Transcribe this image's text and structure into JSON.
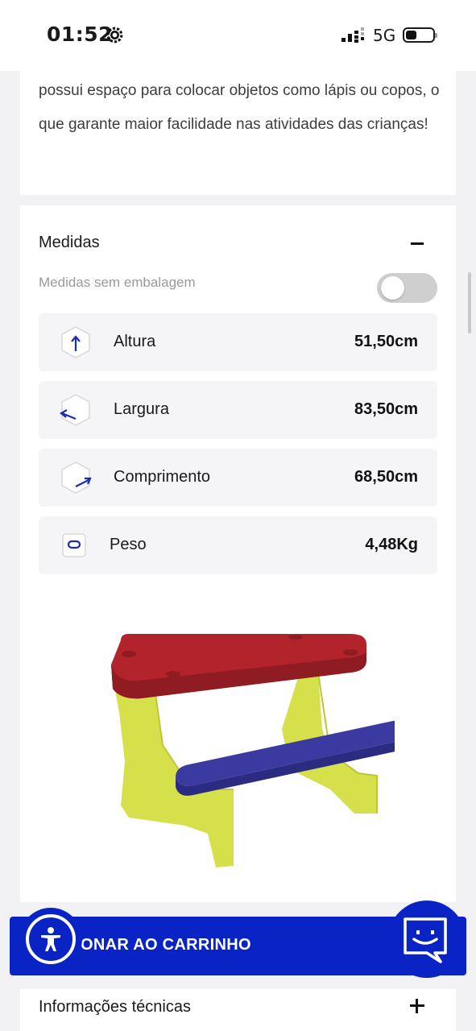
{
  "status_bar": {
    "time": "01:52",
    "network": "5G"
  },
  "description": {
    "text": "possui espaço para colocar objetos como lápis ou copos, o que garante maior facilidade nas atividades das crianças!"
  },
  "measures": {
    "title": "Medidas",
    "toggle_label": "Medidas sem embalagem",
    "toggle_on": false,
    "rows": [
      {
        "icon": "height-box-icon",
        "label": "Altura",
        "value": "51,50cm"
      },
      {
        "icon": "width-box-icon",
        "label": "Largura",
        "value": "83,50cm"
      },
      {
        "icon": "length-box-icon",
        "label": "Comprimento",
        "value": "68,50cm"
      },
      {
        "icon": "weight-icon",
        "label": "Peso",
        "value": "4,48Kg"
      }
    ]
  },
  "product": {
    "colors": {
      "top": "#b3232b",
      "bench": "#3b3aa0",
      "legs": "#d6e04a"
    }
  },
  "cart_button": {
    "label": "ONAR AO CARRINHO"
  },
  "technical_info": {
    "title": "Informações técnicas"
  },
  "colors": {
    "accent": "#0a23c4",
    "row_bg": "#f5f5f7",
    "page_bg": "#f2f2f4"
  }
}
